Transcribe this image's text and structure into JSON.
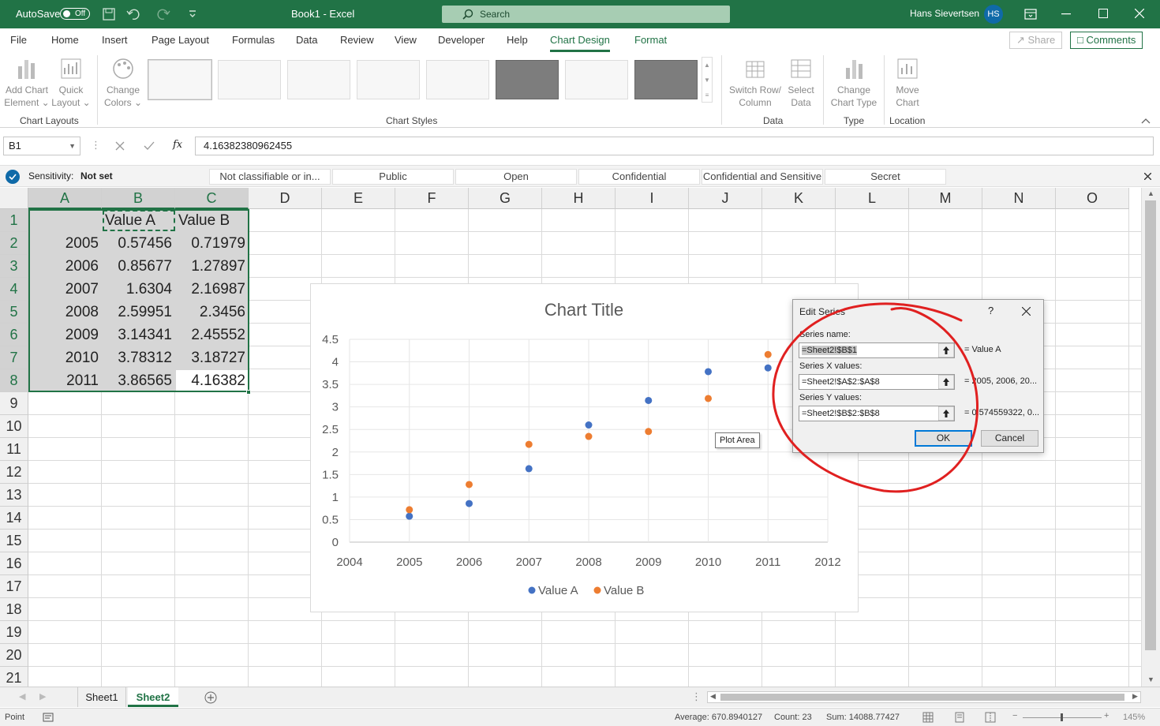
{
  "titlebar": {
    "autosave_label": "AutoSave",
    "autosave_state": "Off",
    "doc_title": "Book1  -  Excel",
    "search_placeholder": "Search",
    "user_name": "Hans Sievertsen",
    "user_initials": "HS"
  },
  "ribbon_tabs": [
    "File",
    "Home",
    "Insert",
    "Page Layout",
    "Formulas",
    "Data",
    "Review",
    "View",
    "Developer",
    "Help",
    "Chart Design",
    "Format"
  ],
  "ribbon_active_tab": "Chart Design",
  "ribbon_actions": {
    "share": "Share",
    "comments": "Comments"
  },
  "ribbon": {
    "add_chart_element": [
      "Add Chart",
      "Element"
    ],
    "quick_layout": [
      "Quick",
      "Layout"
    ],
    "change_colors": [
      "Change",
      "Colors"
    ],
    "switch_row_col": [
      "Switch Row/",
      "Column"
    ],
    "select_data": [
      "Select",
      "Data"
    ],
    "change_chart_type": [
      "Change",
      "Chart Type"
    ],
    "move_chart": [
      "Move",
      "Chart"
    ],
    "groups": {
      "chart_layouts": "Chart Layouts",
      "chart_styles": "Chart Styles",
      "data": "Data",
      "type": "Type",
      "location": "Location"
    }
  },
  "formula_bar": {
    "name_box": "B1",
    "fx": "fx",
    "formula": "4.16382380962455"
  },
  "sensitivity": {
    "label": "Sensitivity:",
    "value": "Not set",
    "options": [
      "Not classifiable or in...",
      "Public",
      "Open",
      "Confidential",
      "Confidential and Sensitive",
      "Secret"
    ]
  },
  "columns": [
    "A",
    "B",
    "C",
    "D",
    "E",
    "F",
    "G",
    "H",
    "I",
    "J",
    "K",
    "L",
    "M",
    "N",
    "O"
  ],
  "rows": [
    "1",
    "2",
    "3",
    "4",
    "5",
    "6",
    "7",
    "8",
    "9",
    "10",
    "11",
    "12",
    "13",
    "14",
    "15",
    "16",
    "17",
    "18",
    "19",
    "20",
    "21"
  ],
  "cells": {
    "B1": "Value A",
    "C1": "Value B",
    "A": [
      "2005",
      "2006",
      "2007",
      "2008",
      "2009",
      "2010",
      "2011"
    ],
    "B": [
      "0.57456",
      "0.85677",
      "1.6304",
      "2.59951",
      "3.14341",
      "3.78312",
      "3.86565"
    ],
    "C": [
      "0.71979",
      "1.27897",
      "2.16987",
      "2.3456",
      "2.45552",
      "3.18727",
      "4.16382"
    ]
  },
  "chart_data": {
    "type": "scatter",
    "title": "Chart Title",
    "xlim": [
      2004,
      2012
    ],
    "ylim": [
      0,
      4.5
    ],
    "x_ticks": [
      "2004",
      "2005",
      "2006",
      "2007",
      "2008",
      "2009",
      "2010",
      "2011",
      "2012"
    ],
    "y_ticks": [
      "0",
      "0.5",
      "1",
      "1.5",
      "2",
      "2.5",
      "3",
      "3.5",
      "4",
      "4.5"
    ],
    "legend_position": "bottom",
    "series": [
      {
        "name": "Value A",
        "color": "#4472c4",
        "x": [
          2005,
          2006,
          2007,
          2008,
          2009,
          2010,
          2011
        ],
        "y": [
          0.57456,
          0.85677,
          1.6304,
          2.59951,
          3.14341,
          3.78312,
          3.86565
        ]
      },
      {
        "name": "Value B",
        "color": "#ed7d31",
        "x": [
          2005,
          2006,
          2007,
          2008,
          2009,
          2010,
          2011
        ],
        "y": [
          0.71979,
          1.27897,
          2.16987,
          2.3456,
          2.45552,
          3.18727,
          4.16382
        ]
      }
    ]
  },
  "tooltip": "Plot Area",
  "dialog": {
    "title": "Edit Series",
    "help": "?",
    "series_name_label": "Series name:",
    "series_name_value": "=Sheet2!$B$1",
    "series_name_result": "= Value A",
    "x_label": "Series X values:",
    "x_value": "=Sheet2!$A$2:$A$8",
    "x_result": "= 2005, 2006, 20...",
    "y_label": "Series Y values:",
    "y_value": "=Sheet2!$B$2:$B$8",
    "y_result": "= 0.574559322, 0...",
    "ok": "OK",
    "cancel": "Cancel"
  },
  "sheets": [
    "Sheet1",
    "Sheet2"
  ],
  "active_sheet": "Sheet2",
  "status": {
    "mode": "Point",
    "average": "Average: 670.8940127",
    "count": "Count: 23",
    "sum": "Sum: 14088.77427",
    "zoom": "145%"
  },
  "colors": {
    "excel_green": "#217346",
    "annotation_red": "#e02020"
  }
}
